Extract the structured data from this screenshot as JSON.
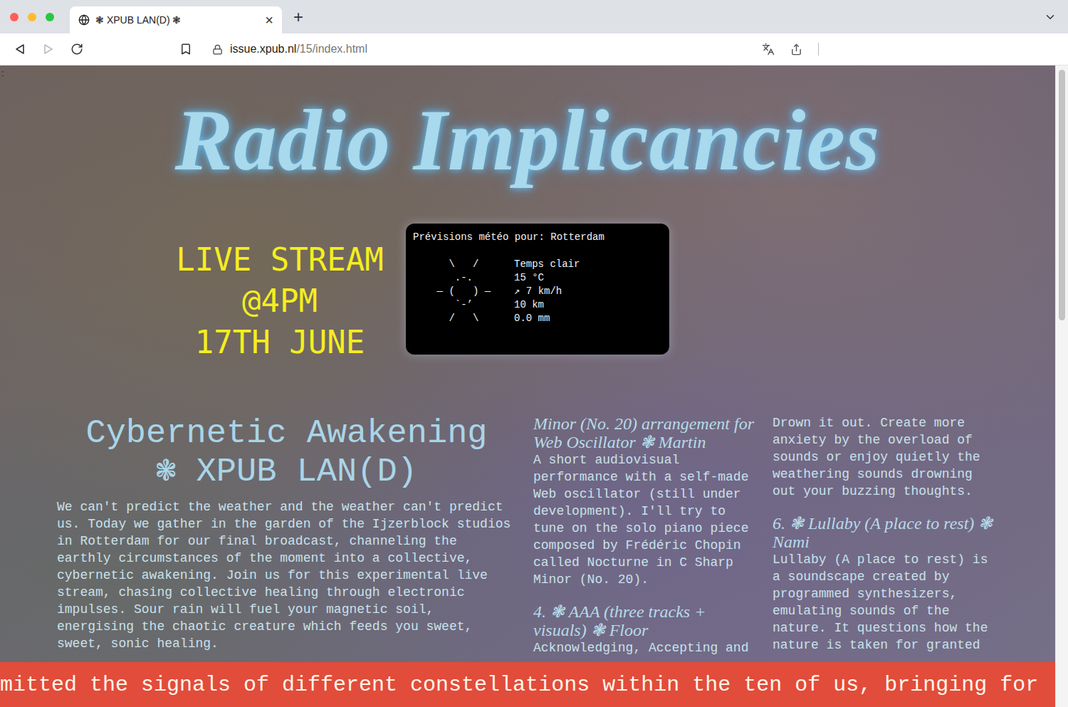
{
  "browser": {
    "tab": {
      "title": "❃ XPUB LAN(D) ❃",
      "close": "×",
      "selected": true
    },
    "new_tab": "+",
    "url": {
      "host": "issue.xpub.nl",
      "path": "/15/index.html"
    },
    "back_enabled": true,
    "forward_enabled": false
  },
  "page": {
    "corner_mark": ":",
    "title": "Radio Implicancies",
    "live": [
      "LIVE STREAM",
      "@4PM",
      "17TH JUNE"
    ],
    "weather": {
      "header": "Prévisions météo pour: Rotterdam",
      "art": [
        "      \\   /",
        "       .-.",
        "    ― (   ) ―",
        "       `-’",
        "      /   \\"
      ],
      "lines": [
        "Temps clair",
        "15 °C",
        "↗ 7 km/h",
        "10 km",
        "0.0 mm"
      ]
    },
    "intro": {
      "heading": [
        "Cybernetic Awakening",
        "❃ XPUB LAN(D)"
      ],
      "body": "We can't predict the weather and the weather can't predict us. Today we gather in the garden of the Ijzerblock studios in Rotterdam for our final broadcast, channeling the earthly circumstances of the moment into a collective, cybernetic awakening. Join us for this experimental live stream, chasing collective healing through electronic impulses. Sour rain will fuel your magnetic soil, energising the chaotic creature which feeds you sweet, sweet, sonic healing."
    },
    "columns": [
      [
        {
          "kind": "heading",
          "text": "Minor (No. 20) arrangement for Web Oscillator ❃ Martin"
        },
        {
          "kind": "paragraph",
          "text": "A short audiovisual performance with a self-made Web oscillator (still under development). I'll try to tune on the solo piano piece composed by Frédéric Chopin called Nocturne in C Sharp Minor (No. 20)."
        },
        {
          "kind": "heading",
          "text": "4. ❃ AAA (three tracks + visuals) ❃ Floor"
        },
        {
          "kind": "paragraph",
          "text": "Acknowledging, Accepting and"
        }
      ],
      [
        {
          "kind": "paragraph",
          "text": "Drown it out. Create more anxiety by the overload of sounds or enjoy quietly the weathering sounds drowning out your buzzing thoughts."
        },
        {
          "kind": "heading",
          "text": "6. ❃ Lullaby (A place to rest) ❃ Nami"
        },
        {
          "kind": "paragraph",
          "text": "Lullaby (A place to rest) is a soundscape created by programmed synthesizers, emulating sounds of the nature. It questions how the nature is taken for granted"
        }
      ]
    ],
    "marquee": "mitted the signals of different constellations within the ten of us, bringing for"
  }
}
